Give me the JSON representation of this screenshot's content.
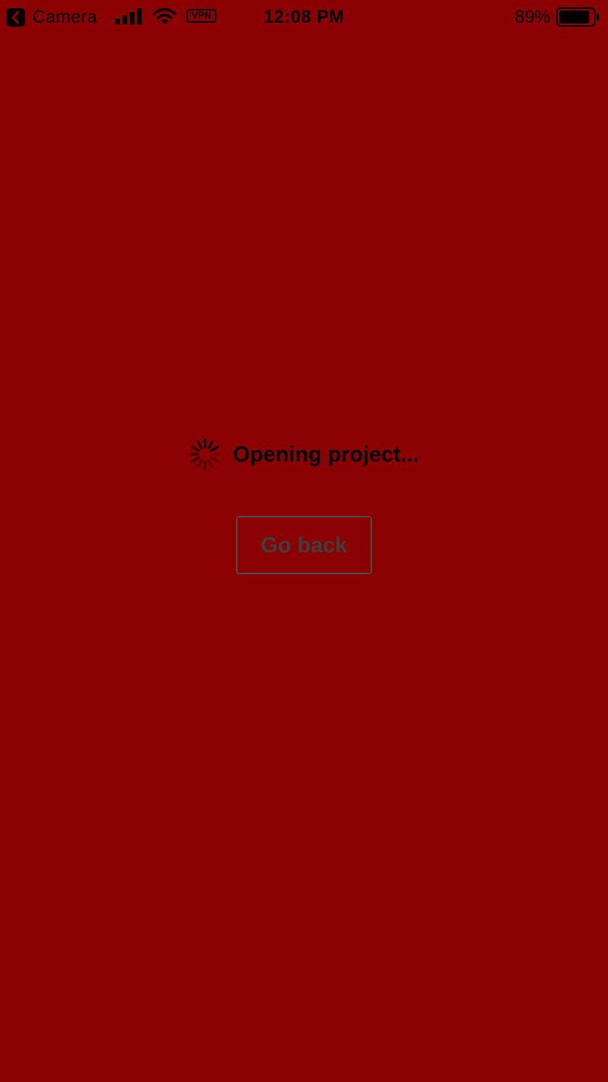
{
  "status_bar": {
    "back_app_label": "Camera",
    "vpn_label": "VPN",
    "time": "12:08 PM",
    "battery_percent": "89%",
    "battery_level": 0.89,
    "signal_bars": 4,
    "icons": {
      "back": "chevron-left-square-icon",
      "signal": "cellular-signal-icon",
      "wifi": "wifi-icon",
      "battery": "battery-icon"
    }
  },
  "loading": {
    "text": "Opening project...",
    "icon": "spinner-icon"
  },
  "actions": {
    "go_back_label": "Go back"
  },
  "colors": {
    "background": "#8b0000",
    "foreground": "#000000",
    "button_text": "#3f3f3f",
    "button_border": "#4a4a4a"
  }
}
